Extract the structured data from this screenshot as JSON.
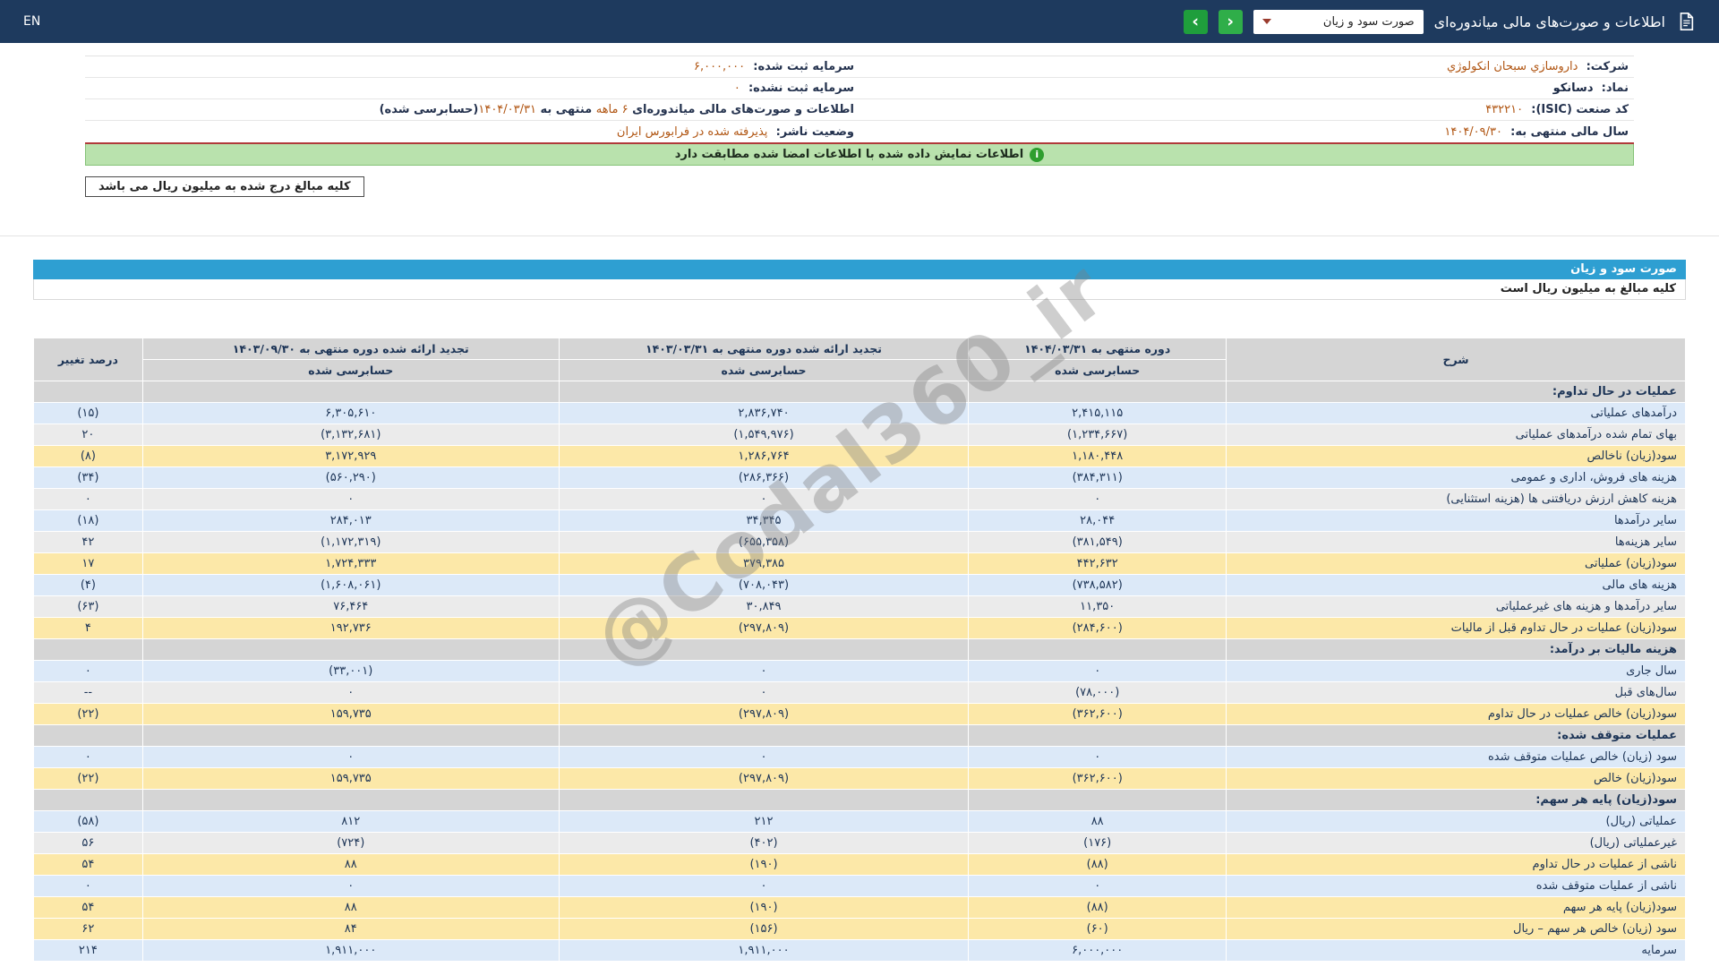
{
  "colors": {
    "navbar_bg": "#1e3a5e",
    "accent_blue": "#2e9fd2",
    "highlight_yellow": "#fce8a8",
    "row_blue": "#dce9f8",
    "row_gray": "#ebebeb",
    "section_gray": "#d5d5d5",
    "negative_red": "#cc0000",
    "value_navy": "#1d3557",
    "green_button": "#2fae49",
    "green_button_dark": "#1f9e3c",
    "notice_green_bg": "#b9e2ad",
    "orange_value": "#b05512",
    "red_divider": "#b03a3a"
  },
  "navbar": {
    "en_label": "EN",
    "title": "اطلاعات و صورت‌های مالی میاندوره‌ای",
    "report_select_value": "صورت سود و زیان",
    "prev_glyph": "‹",
    "next_glyph": "›"
  },
  "company_info": {
    "right": [
      {
        "label": "شرکت:",
        "value": "داروسازي سبحان انکولوژي"
      },
      {
        "label": "نماد:",
        "value": "دسانکو"
      },
      {
        "label": "کد صنعت (ISIC):",
        "value": "۴۳۲۲۱۰"
      },
      {
        "label": "سال مالی منتهی به:",
        "value": "۱۴۰۴/۰۹/۳۰"
      }
    ],
    "left": [
      {
        "label": "سرمایه ثبت شده:",
        "value": "۶,۰۰۰,۰۰۰"
      },
      {
        "label": "سرمایه ثبت نشده:",
        "value": "۰"
      },
      {
        "label": "وضعیت ناشر:",
        "value": "پذیرفته شده در فرابورس ایران"
      }
    ],
    "period_line": {
      "p1": "اطلاعات و صورت‌های مالی میاندوره‌ای ",
      "p2": "۶ ماهه",
      "p3": " منتهی به ",
      "p4": "۱۴۰۴/۰۳/۳۱",
      "p5": "(حسابرسی شده)"
    }
  },
  "notice_text": "اطلاعات نمایش داده شده با اطلاعات امضا شده مطابقت دارد",
  "notice_icon_glyph": "i",
  "unit_box_text": "کلیه مبالغ درج شده به میلیون ریال می باشد",
  "watermark": {
    "text": "@Codal360_ir"
  },
  "statement": {
    "title": "صورت سود و زیان",
    "unit_note": "کلیه مبالغ به میلیون ریال است",
    "columns": {
      "desc": "شرح",
      "period1_title": "دوره منتهی به ۱۴۰۴/۰۳/۳۱",
      "period2_title": "تجدید ارائه شده دوره منتهی به ۱۴۰۳/۰۳/۳۱",
      "period3_title": "تجدید ارائه شده دوره منتهی به ۱۴۰۳/۰۹/۳۰",
      "audited": "حسابرسی شده",
      "change": "درصد تغییر"
    },
    "rows": [
      {
        "type": "section",
        "desc": "عملیات در حال تداوم:"
      },
      {
        "type": "data",
        "style": "blue",
        "desc": "درآمدهای عملیاتی",
        "v1": "۲,۴۱۵,۱۱۵",
        "v2": "۲,۸۳۶,۷۴۰",
        "v3": "۶,۳۰۵,۶۱۰",
        "chg": "(۱۵)"
      },
      {
        "type": "data",
        "style": "gray",
        "desc": "بهای تمام شده درآمدهای عملیاتی",
        "v1": "(۱,۲۳۴,۶۶۷)",
        "v2": "(۱,۵۴۹,۹۷۶)",
        "v3": "(۳,۱۳۲,۶۸۱)",
        "chg": "۲۰"
      },
      {
        "type": "data",
        "style": "yellow",
        "desc": "سود(زیان) ناخالص",
        "v1": "۱,۱۸۰,۴۴۸",
        "v2": "۱,۲۸۶,۷۶۴",
        "v3": "۳,۱۷۲,۹۲۹",
        "chg": "(۸)"
      },
      {
        "type": "data",
        "style": "blue",
        "desc": "هزینه های فروش، اداری و عمومی",
        "v1": "(۳۸۴,۳۱۱)",
        "v2": "(۲۸۶,۳۶۶)",
        "v3": "(۵۶۰,۲۹۰)",
        "chg": "(۳۴)"
      },
      {
        "type": "data",
        "style": "gray",
        "desc": "هزینه کاهش ارزش دریافتنی ها (هزینه استثنایی)",
        "v1": "۰",
        "v2": "۰",
        "v3": "۰",
        "chg": "۰"
      },
      {
        "type": "data",
        "style": "blue",
        "desc": "سایر درآمدها",
        "v1": "۲۸,۰۴۴",
        "v2": "۳۴,۳۴۵",
        "v3": "۲۸۴,۰۱۳",
        "chg": "(۱۸)"
      },
      {
        "type": "data",
        "style": "gray",
        "desc": "سایر هزینه‌ها",
        "v1": "(۳۸۱,۵۴۹)",
        "v2": "(۶۵۵,۳۵۸)",
        "v3": "(۱,۱۷۲,۳۱۹)",
        "chg": "۴۲"
      },
      {
        "type": "data",
        "style": "yellow",
        "desc": "سود(زیان) عملیاتی",
        "v1": "۴۴۲,۶۳۲",
        "v2": "۳۷۹,۳۸۵",
        "v3": "۱,۷۲۴,۳۳۳",
        "chg": "۱۷"
      },
      {
        "type": "data",
        "style": "blue",
        "desc": "هزینه های مالی",
        "v1": "(۷۳۸,۵۸۲)",
        "v2": "(۷۰۸,۰۴۳)",
        "v3": "(۱,۶۰۸,۰۶۱)",
        "chg": "(۴)"
      },
      {
        "type": "data",
        "style": "gray",
        "desc": "سایر درآمدها و هزینه های غیرعملیاتی",
        "v1": "۱۱,۳۵۰",
        "v2": "۳۰,۸۴۹",
        "v3": "۷۶,۴۶۴",
        "chg": "(۶۳)"
      },
      {
        "type": "data",
        "style": "yellow",
        "desc": "سود(زیان) عملیات در حال تداوم قبل از مالیات",
        "v1": "(۲۸۴,۶۰۰)",
        "v2": "(۲۹۷,۸۰۹)",
        "v3": "۱۹۲,۷۳۶",
        "chg": "۴"
      },
      {
        "type": "section",
        "desc": "هزینه مالیات بر درآمد:"
      },
      {
        "type": "data",
        "style": "blue",
        "desc": "سال جاری",
        "v1": "۰",
        "v2": "۰",
        "v3": "(۳۳,۰۰۱)",
        "chg": "۰"
      },
      {
        "type": "data",
        "style": "gray",
        "desc": "سال‌های قبل",
        "v1": "(۷۸,۰۰۰)",
        "v2": "۰",
        "v3": "۰",
        "chg": "--"
      },
      {
        "type": "data",
        "style": "yellow",
        "desc": "سود(زیان) خالص عملیات در حال تداوم",
        "v1": "(۳۶۲,۶۰۰)",
        "v2": "(۲۹۷,۸۰۹)",
        "v3": "۱۵۹,۷۳۵",
        "chg": "(۲۲)"
      },
      {
        "type": "section",
        "desc": "عملیات متوقف شده:"
      },
      {
        "type": "data",
        "style": "blue",
        "desc": "سود (زیان) خالص عملیات متوقف شده",
        "v1": "۰",
        "v2": "۰",
        "v3": "۰",
        "chg": "۰"
      },
      {
        "type": "data",
        "style": "yellow",
        "desc": "سود(زیان) خالص",
        "v1": "(۳۶۲,۶۰۰)",
        "v2": "(۲۹۷,۸۰۹)",
        "v3": "۱۵۹,۷۳۵",
        "chg": "(۲۲)"
      },
      {
        "type": "section",
        "desc": "سود(زیان) پایه هر سهم:"
      },
      {
        "type": "data",
        "style": "blue",
        "desc": "عملیاتی (ریال)",
        "v1": "۸۸",
        "v2": "۲۱۲",
        "v3": "۸۱۲",
        "chg": "(۵۸)"
      },
      {
        "type": "data",
        "style": "gray",
        "desc": "غیرعملیاتی (ریال)",
        "v1": "(۱۷۶)",
        "v2": "(۴۰۲)",
        "v3": "(۷۲۴)",
        "chg": "۵۶"
      },
      {
        "type": "data",
        "style": "yellow",
        "desc": "ناشی از عملیات در حال تداوم",
        "v1": "(۸۸)",
        "v2": "(۱۹۰)",
        "v3": "۸۸",
        "chg": "۵۴"
      },
      {
        "type": "data",
        "style": "blue",
        "desc": "ناشی از عملیات متوقف شده",
        "v1": "۰",
        "v2": "۰",
        "v3": "۰",
        "chg": "۰"
      },
      {
        "type": "data",
        "style": "yellow",
        "desc": "سود(زیان) پایه هر سهم",
        "v1": "(۸۸)",
        "v2": "(۱۹۰)",
        "v3": "۸۸",
        "chg": "۵۴"
      },
      {
        "type": "data",
        "style": "yellow",
        "desc": "سود (زیان) خالص هر سهم – ریال",
        "v1": "(۶۰)",
        "v2": "(۱۵۶)",
        "v3": "۸۴",
        "chg": "۶۲"
      },
      {
        "type": "data",
        "style": "blue",
        "desc": "سرمایه",
        "v1": "۶,۰۰۰,۰۰۰",
        "v2": "۱,۹۱۱,۰۰۰",
        "v3": "۱,۹۱۱,۰۰۰",
        "chg": "۲۱۴"
      }
    ]
  }
}
